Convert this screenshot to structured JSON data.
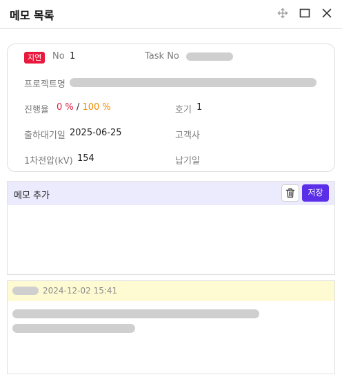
{
  "window": {
    "title": "메모 목록",
    "icons": [
      "move-icon",
      "maximize-icon",
      "close-icon"
    ]
  },
  "info": {
    "status_badge": "지연",
    "no_label": "No",
    "no_value": "1",
    "task_no_label": "Task No",
    "project_label": "프로젝트명",
    "progress_label": "진행율",
    "progress_actual": "0",
    "progress_target": "100",
    "percent_sign": "%",
    "progress_separator": "/",
    "unit_label": "호기",
    "unit_value": "1",
    "ship_date_label": "출하대기일",
    "ship_date_value": "2025-06-25",
    "customer_label": "고객사",
    "voltage_label": "1차전압(kV)",
    "voltage_value": "154",
    "delivery_label": "납기일"
  },
  "memo_add": {
    "label": "메모 추가",
    "save_label": "저장",
    "text_value": ""
  },
  "memos": [
    {
      "date": "2024-12-02 15:41"
    }
  ],
  "colors": {
    "accent": "#5b2ee8",
    "badge": "#e8193c",
    "progress_actual": "#e8193c",
    "progress_target": "#f08a00",
    "memo_header_bg": "#fefbd3",
    "memo_add_header_bg": "#ecebfd"
  }
}
